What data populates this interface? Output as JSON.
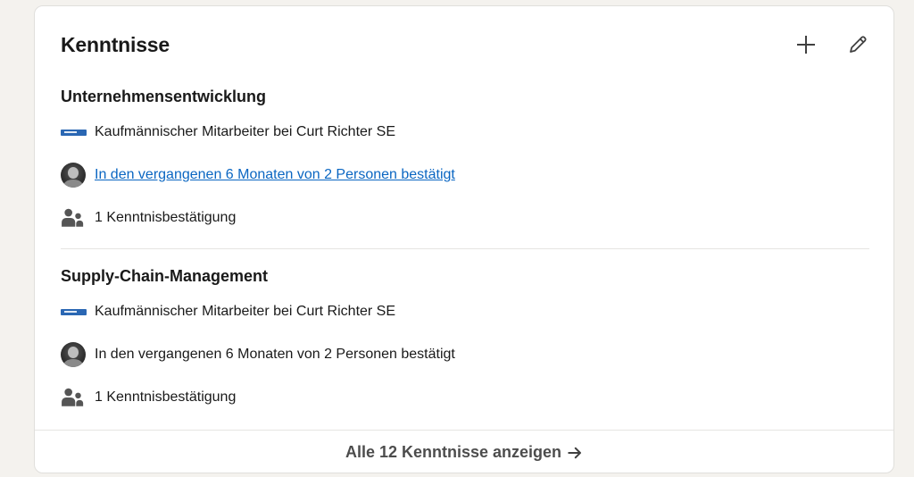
{
  "card": {
    "title": "Kenntnisse",
    "add_icon": "plus-icon",
    "edit_icon": "pencil-icon"
  },
  "skills": [
    {
      "name": "Unternehmensentwicklung",
      "company_text": "Kaufmännischer Mitarbeiter bei Curt Richter SE",
      "endorsement_text": "In den vergangenen 6 Monaten von 2 Personen bestätigt",
      "endorsement_is_link": true,
      "count_text": "1 Kenntnisbestätigung"
    },
    {
      "name": "Supply-Chain-Management",
      "company_text": "Kaufmännischer Mitarbeiter bei Curt Richter SE",
      "endorsement_text": "In den vergangenen 6 Monaten von 2 Personen bestätigt",
      "endorsement_is_link": false,
      "count_text": "1 Kenntnisbestätigung"
    }
  ],
  "footer": {
    "label": "Alle 12 Kenntnisse anzeigen",
    "arrow_icon": "arrow-right-icon"
  },
  "colors": {
    "link": "#0a66c2",
    "company_logo": "#2a67b3",
    "page_background": "#f4f2ee"
  }
}
